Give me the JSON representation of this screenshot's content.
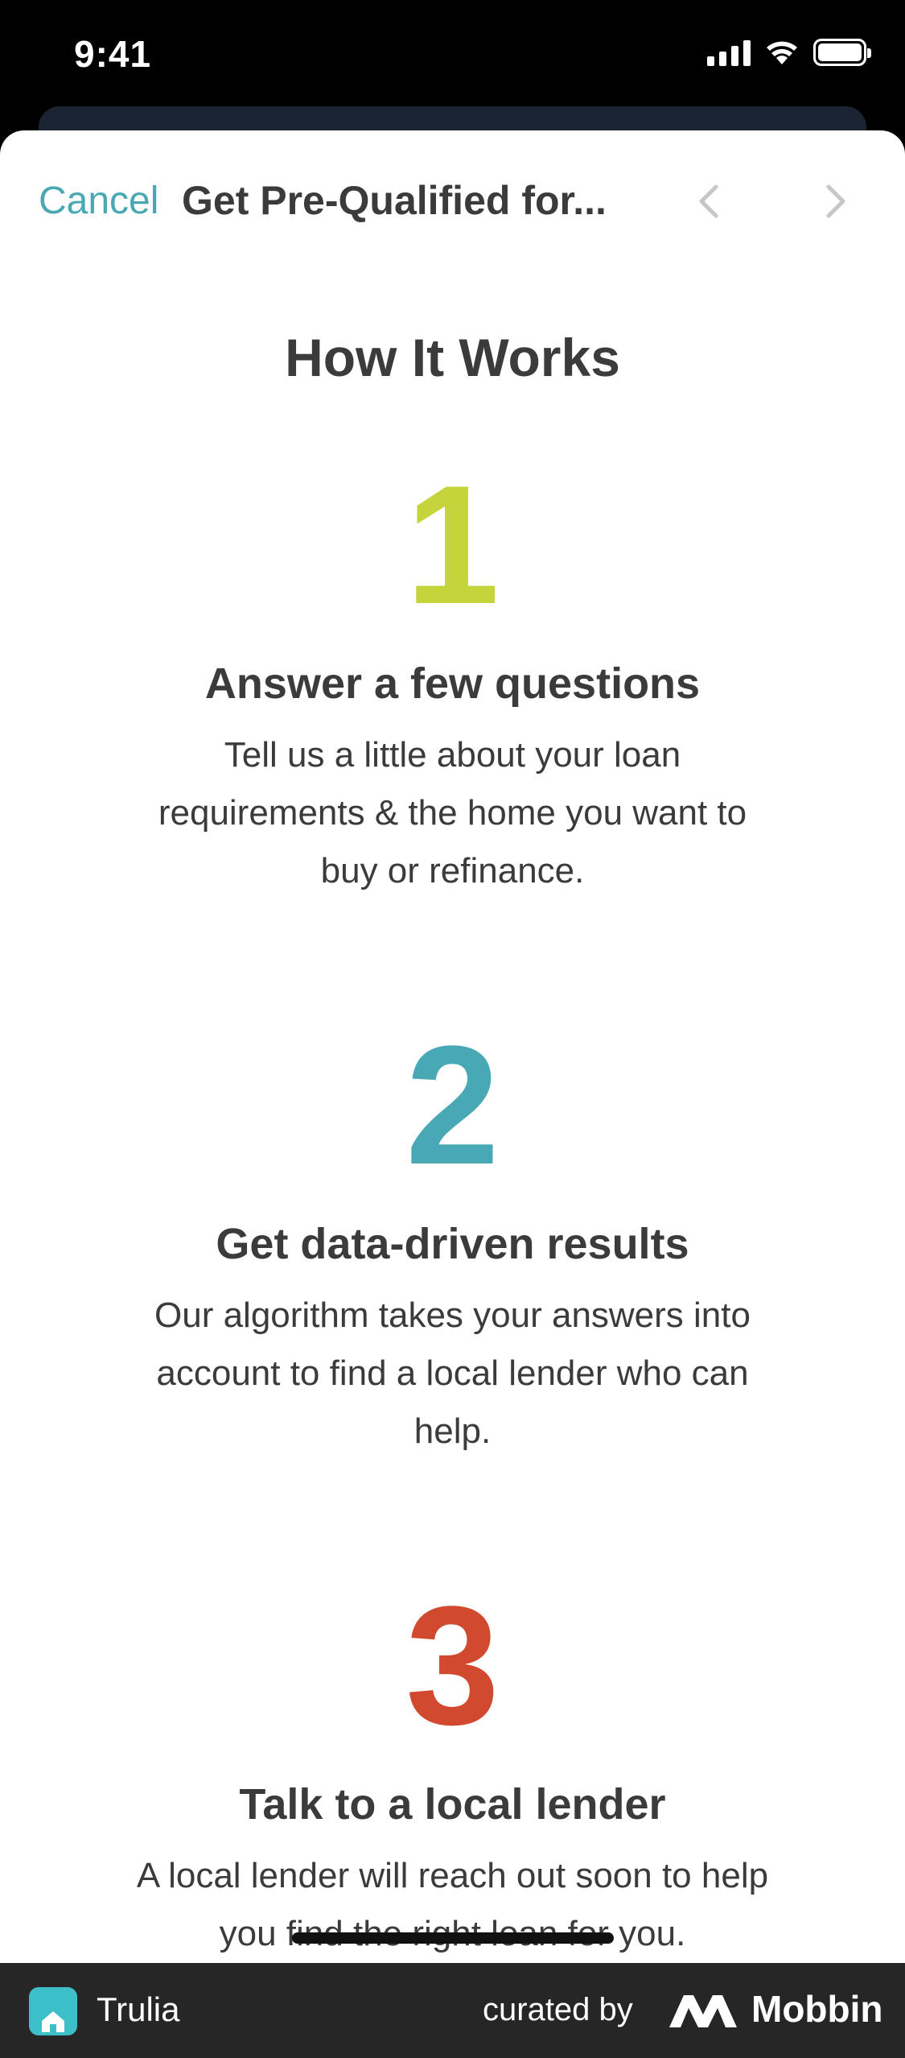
{
  "status_bar": {
    "time": "9:41"
  },
  "nav": {
    "cancel_label": "Cancel",
    "title": "Get Pre-Qualified for..."
  },
  "main": {
    "heading": "How It Works",
    "steps": [
      {
        "number": "1",
        "color": "#c5d43a",
        "title": "Answer a few questions",
        "desc_lines": [
          "Tell us a little about your loan",
          "requirements & the home you want to",
          "buy or refinance."
        ]
      },
      {
        "number": "2",
        "color": "#48a9b5",
        "title": "Get data-driven results",
        "desc_lines": [
          "Our algorithm takes your answers into",
          "account to find a local lender who can",
          "help."
        ]
      },
      {
        "number": "3",
        "color": "#d14a2f",
        "title": "Talk to a local lender",
        "desc_lines": [
          "A local lender will reach out soon to help",
          "you find the right loan for you."
        ]
      }
    ]
  },
  "footer": {
    "app_name": "Trulia",
    "curated_by": "curated by",
    "brand": "Mobbin"
  },
  "colors": {
    "accent": "#48a9b5",
    "text": "#3b3b3b",
    "footer_bg": "#262626"
  }
}
